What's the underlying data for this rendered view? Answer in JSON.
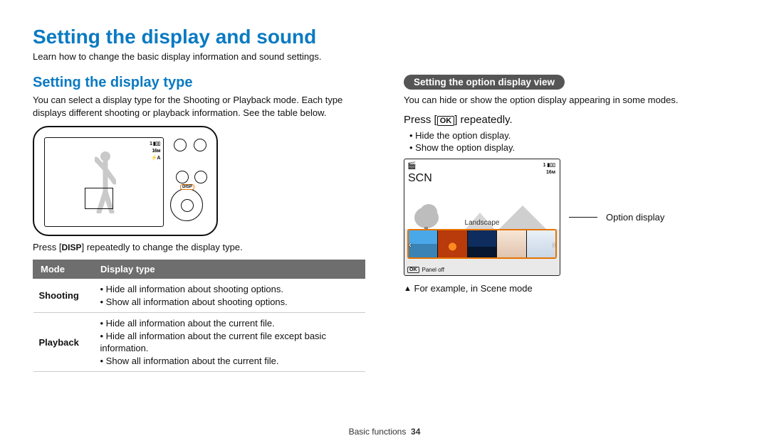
{
  "page": {
    "title": "Setting the display and sound",
    "intro": "Learn how to change the basic display information and sound settings."
  },
  "left": {
    "heading": "Setting the display type",
    "body": "You can select a display type for the Shooting or Playback mode. Each type displays different shooting or playback information. See the table below.",
    "camera_screen": {
      "indicator_line1": "1  ▮▯▯",
      "indicator_size": "16ᴍ",
      "indicator_flash": "⚡A"
    },
    "disp_button_label": "DISP",
    "caption_pre": "Press [",
    "disp_inline": "DISP",
    "caption_post": "] repeatedly to change the display type.",
    "table": {
      "header_mode": "Mode",
      "header_type": "Display type",
      "rows": [
        {
          "mode": "Shooting",
          "items": [
            "Hide all information about shooting options.",
            "Show all information about shooting options."
          ]
        },
        {
          "mode": "Playback",
          "items": [
            "Hide all information about the current file.",
            "Hide all information about the current file except basic information.",
            "Show all information about the current file."
          ]
        }
      ]
    }
  },
  "right": {
    "pill": "Setting the option display view",
    "body": "You can hide or show the option display appearing in some modes.",
    "press_pre": "Press [",
    "ok_label": "OK",
    "press_post": "] repeatedly.",
    "bullets": [
      "Hide the option display.",
      "Show the option display."
    ],
    "scene": {
      "scn_label": "SCN",
      "top_indicator_line1": "1  ▮▯▯",
      "top_indicator_size": "16ᴍ",
      "strip_title": "Landscape",
      "ok_small": "OK",
      "panel_off": "Panel off"
    },
    "callout": "Option display",
    "footnote_tri": "▲",
    "footnote": "For example, in Scene mode"
  },
  "footer": {
    "section": "Basic functions",
    "page_number": "34"
  }
}
